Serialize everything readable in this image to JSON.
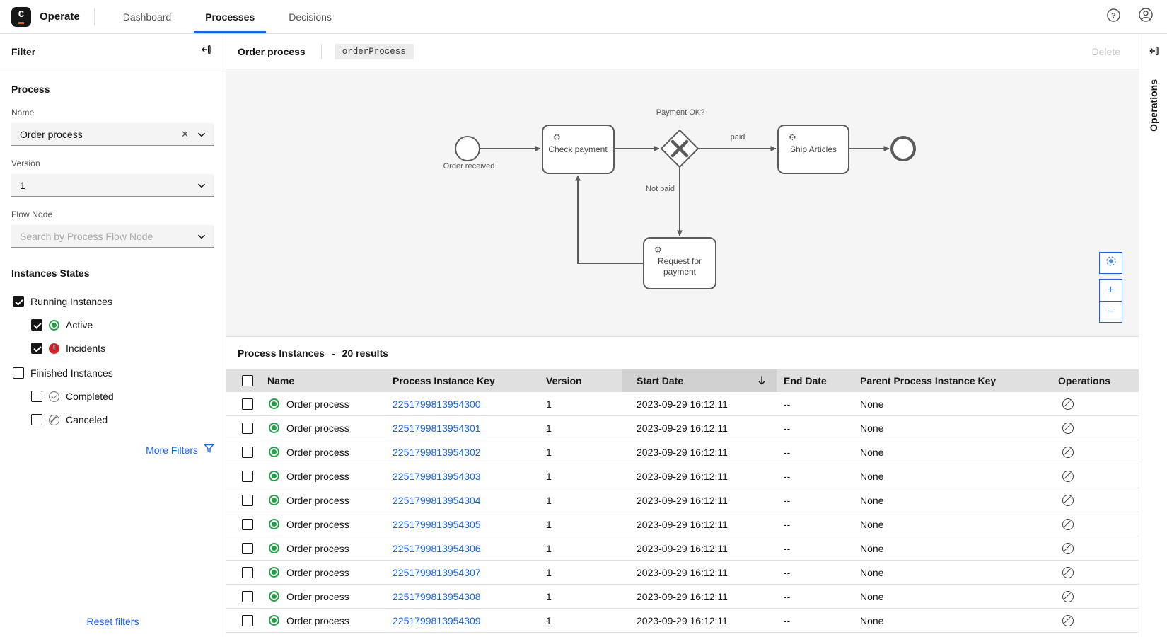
{
  "colors": {
    "accent": "#0f62fe",
    "active_green": "#24a148",
    "incident_red": "#da1e28",
    "link_blue": "#0f62fe",
    "logo_orange": "#fc5d0d"
  },
  "nav": {
    "logo_letter": "C",
    "app_name": "Operate",
    "tabs": [
      {
        "label": "Dashboard"
      },
      {
        "label": "Processes"
      },
      {
        "label": "Decisions"
      }
    ]
  },
  "filter": {
    "title": "Filter",
    "process": {
      "heading": "Process",
      "name_label": "Name",
      "name_value": "Order process",
      "version_label": "Version",
      "version_value": "1",
      "flow_node_label": "Flow Node",
      "flow_node_placeholder": "Search by Process Flow Node"
    },
    "states": {
      "heading": "Instances States",
      "running": "Running Instances",
      "active": "Active",
      "incidents": "Incidents",
      "finished": "Finished Instances",
      "completed": "Completed",
      "canceled": "Canceled"
    },
    "more_filters": "More Filters",
    "reset": "Reset filters"
  },
  "process_panel": {
    "title": "Order process",
    "process_id": "orderProcess",
    "delete_label": "Delete"
  },
  "bpmn": {
    "start_event": "Order received",
    "check_payment": "Check payment",
    "gateway": "Payment OK?",
    "paid": "paid",
    "not_paid": "Not paid",
    "ship_articles": "Ship Articles",
    "end_event": "",
    "request_line1": "Request for",
    "request_line2": "payment"
  },
  "instances": {
    "title": "Process Instances",
    "separator": "-",
    "results": "20 results",
    "columns": {
      "name": "Name",
      "key": "Process Instance Key",
      "version": "Version",
      "start": "Start Date",
      "end": "End Date",
      "parent": "Parent Process Instance Key",
      "operations": "Operations"
    },
    "rows": [
      {
        "name": "Order process",
        "key": "2251799813954300",
        "version": "1",
        "start_date": "2023-09-29 16:12:11",
        "end_date": "--",
        "parent": "None"
      },
      {
        "name": "Order process",
        "key": "2251799813954301",
        "version": "1",
        "start_date": "2023-09-29 16:12:11",
        "end_date": "--",
        "parent": "None"
      },
      {
        "name": "Order process",
        "key": "2251799813954302",
        "version": "1",
        "start_date": "2023-09-29 16:12:11",
        "end_date": "--",
        "parent": "None"
      },
      {
        "name": "Order process",
        "key": "2251799813954303",
        "version": "1",
        "start_date": "2023-09-29 16:12:11",
        "end_date": "--",
        "parent": "None"
      },
      {
        "name": "Order process",
        "key": "2251799813954304",
        "version": "1",
        "start_date": "2023-09-29 16:12:11",
        "end_date": "--",
        "parent": "None"
      },
      {
        "name": "Order process",
        "key": "2251799813954305",
        "version": "1",
        "start_date": "2023-09-29 16:12:11",
        "end_date": "--",
        "parent": "None"
      },
      {
        "name": "Order process",
        "key": "2251799813954306",
        "version": "1",
        "start_date": "2023-09-29 16:12:11",
        "end_date": "--",
        "parent": "None"
      },
      {
        "name": "Order process",
        "key": "2251799813954307",
        "version": "1",
        "start_date": "2023-09-29 16:12:11",
        "end_date": "--",
        "parent": "None"
      },
      {
        "name": "Order process",
        "key": "2251799813954308",
        "version": "1",
        "start_date": "2023-09-29 16:12:11",
        "end_date": "--",
        "parent": "None"
      },
      {
        "name": "Order process",
        "key": "2251799813954309",
        "version": "1",
        "start_date": "2023-09-29 16:12:11",
        "end_date": "--",
        "parent": "None"
      }
    ]
  },
  "rail": {
    "label": "Operations"
  }
}
